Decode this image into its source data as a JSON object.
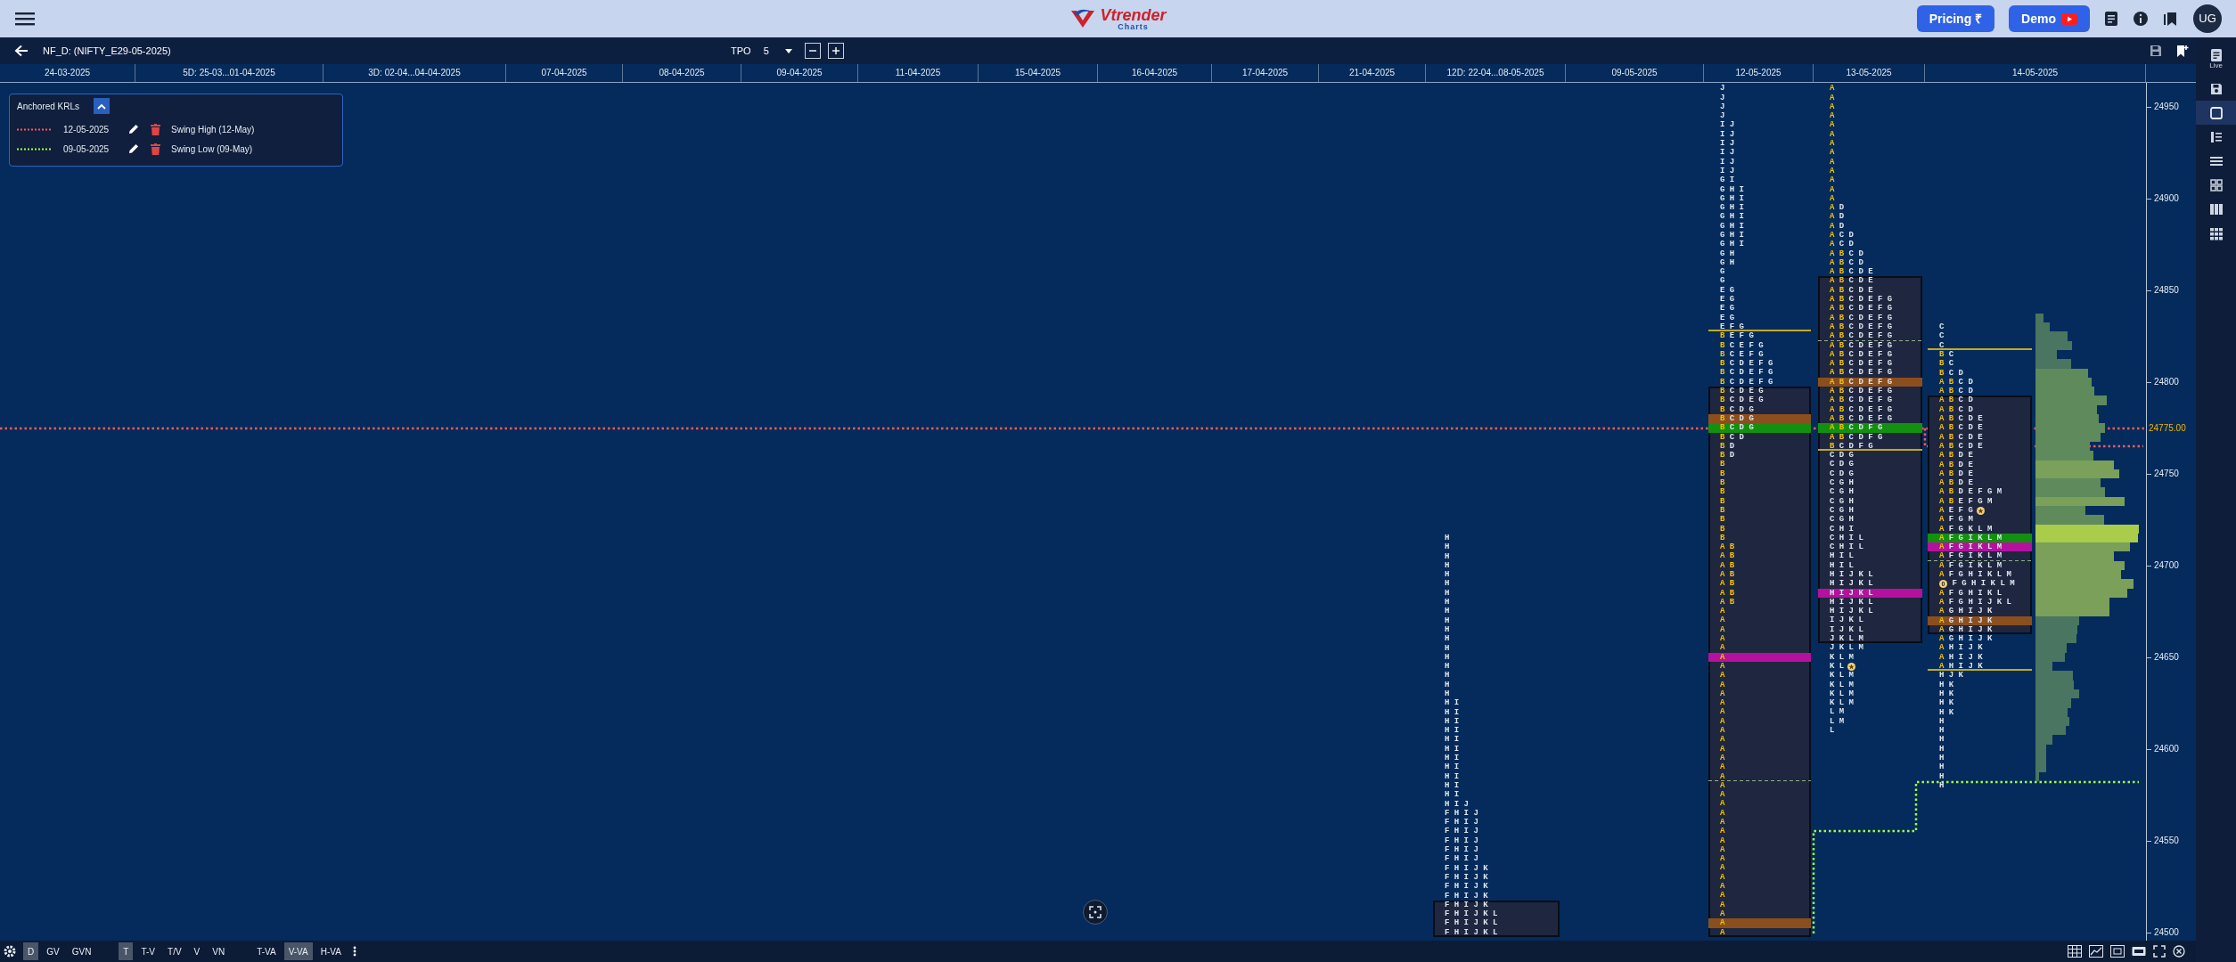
{
  "topbar": {
    "brand": "Vtrender",
    "brand_sub": "Charts",
    "buttons": [
      {
        "label": "Pricing ₹",
        "kind": "pricing"
      },
      {
        "label": "Demo",
        "kind": "demo"
      }
    ],
    "avatar": "UG"
  },
  "toolbar": {
    "symbol": "NF_D: (NIFTY_E29-05-2025)",
    "mode": "TPO",
    "tpo_size": "5"
  },
  "krl_panel": {
    "title": "Anchored KRLs",
    "expanded": true,
    "items": [
      {
        "date": "12-05-2025",
        "label": "Swing High (12-May)",
        "color": "#ff5a5a"
      },
      {
        "date": "09-05-2025",
        "label": "Swing Low (09-May)",
        "color": "#a4ff3c"
      }
    ]
  },
  "columns": [
    {
      "label": "24-03-2025"
    },
    {
      "label": "5D: 25-03...01-04-2025"
    },
    {
      "label": "3D: 02-04...04-04-2025"
    },
    {
      "label": "07-04-2025"
    },
    {
      "label": "08-04-2025"
    },
    {
      "label": "09-04-2025"
    },
    {
      "label": "11-04-2025"
    },
    {
      "label": "15-04-2025"
    },
    {
      "label": "16-04-2025"
    },
    {
      "label": "17-04-2025"
    },
    {
      "label": "21-04-2025"
    },
    {
      "label": "12D: 22-04...08-05-2025",
      "profile": {
        "histogram": false,
        "above_va": [
          {
            "tpo": "H"
          },
          {
            "tpo": "H"
          },
          {
            "tpo": "H"
          },
          {
            "tpo": "H"
          },
          {
            "tpo": "H"
          },
          {
            "tpo": "H"
          },
          {
            "tpo": "H"
          },
          {
            "tpo": "H"
          },
          {
            "tpo": "H"
          },
          {
            "tpo": "H"
          },
          {
            "tpo": "H"
          },
          {
            "tpo": "H"
          },
          {
            "tpo": "H"
          },
          {
            "tpo": "H"
          },
          {
            "tpo": "H"
          },
          {
            "tpo": "H"
          },
          {
            "tpo": "H"
          },
          {
            "tpo": "H"
          },
          {
            "tpo": "H I"
          },
          {
            "tpo": "H I"
          },
          {
            "tpo": "H I"
          },
          {
            "tpo": "H I"
          },
          {
            "tpo": "H I"
          },
          {
            "tpo": "H I"
          },
          {
            "tpo": "H I"
          },
          {
            "tpo": "H I"
          },
          {
            "tpo": "H I"
          },
          {
            "tpo": "H I"
          },
          {
            "tpo": "H I"
          },
          {
            "tpo": "H I J"
          },
          {
            "tpo": "F H I J"
          },
          {
            "tpo": "F H I J"
          },
          {
            "tpo": "F H I J"
          },
          {
            "tpo": "F H I J"
          },
          {
            "tpo": "F H I J"
          },
          {
            "tpo": "F H I J"
          },
          {
            "tpo": "F H I J K"
          },
          {
            "tpo": "F H I J K"
          },
          {
            "tpo": "F H I J K"
          },
          {
            "tpo": "F H I J K"
          }
        ],
        "value_area": [
          {
            "tpo": "F H I J K"
          },
          {
            "tpo": "F H I J K L"
          },
          {
            "tpo": "F H I J K L"
          },
          {
            "tpo": "F H I J K L"
          }
        ]
      }
    },
    {
      "label": "09-05-2025"
    },
    {
      "label": "12-05-2025",
      "profile": {
        "histogram": false,
        "above_va": [
          {
            "tpo": "J"
          },
          {
            "tpo": "J"
          },
          {
            "tpo": "J"
          },
          {
            "tpo": "J"
          },
          {
            "tpo": "I J"
          },
          {
            "tpo": "I J"
          },
          {
            "tpo": "I J"
          },
          {
            "tpo": "I J"
          },
          {
            "tpo": "I J"
          },
          {
            "tpo": "I J"
          },
          {
            "tpo": "G I"
          },
          {
            "tpo": "G H I"
          },
          {
            "tpo": "G H I"
          },
          {
            "tpo": "G H I"
          },
          {
            "tpo": "G H I"
          },
          {
            "tpo": "G H I"
          },
          {
            "tpo": "G H I"
          },
          {
            "tpo": "G H I"
          },
          {
            "tpo": "G H"
          },
          {
            "tpo": "G H"
          },
          {
            "tpo": "G"
          },
          {
            "tpo": "G"
          },
          {
            "tpo": "E G"
          },
          {
            "tpo": "E G"
          },
          {
            "tpo": "E G"
          },
          {
            "tpo": "E G"
          },
          {
            "tpo": "E F G",
            "kind": "solid-rule"
          },
          {
            "ib": "B",
            "tpo": "E F G"
          },
          {
            "ib": "B",
            "tpo": "C E F G"
          },
          {
            "ib": "B",
            "tpo": "C E F G"
          },
          {
            "ib": "B",
            "tpo": "C D E F G"
          },
          {
            "ib": "B",
            "tpo": "C D E F G"
          },
          {
            "ib": "B",
            "tpo": "C D E F G"
          }
        ],
        "value_area": [
          {
            "ib": "B",
            "tpo": "C D E G"
          },
          {
            "ib": "B",
            "tpo": "C D E G"
          },
          {
            "ib": "B",
            "tpo": "C D G"
          },
          {
            "ib": "B",
            "tpo": "C D G",
            "color": "#8b4f1d"
          },
          {
            "ib": "B",
            "tpo": "C D G",
            "color": "#13900f"
          },
          {
            "ib": "B",
            "tpo": "C D"
          },
          {
            "ib": "B",
            "tpo": "D"
          },
          {
            "ib": "B",
            "tpo": "D"
          },
          {
            "ib": "B"
          },
          {
            "ib": "B"
          },
          {
            "ib": "B"
          },
          {
            "ib": "B"
          },
          {
            "ib": "B"
          },
          {
            "ib": "B"
          },
          {
            "ib": "B"
          },
          {
            "ib": "B"
          },
          {
            "ib": "B"
          },
          {
            "ib": "A B"
          },
          {
            "ib": "A B"
          },
          {
            "ib": "A B"
          },
          {
            "ib": "A B"
          },
          {
            "ib": "A B"
          },
          {
            "ib": "A B"
          },
          {
            "ib": "A B"
          },
          {
            "ib": "A"
          },
          {
            "ib": "A"
          },
          {
            "ib": "A"
          },
          {
            "ib": "A"
          },
          {
            "ib": "A"
          },
          {
            "ib": "A",
            "color": "#b5119e"
          },
          {
            "ib": "A"
          },
          {
            "ib": "A"
          },
          {
            "ib": "A"
          },
          {
            "ib": "A"
          },
          {
            "ib": "A"
          },
          {
            "ib": "A"
          },
          {
            "ib": "A"
          },
          {
            "ib": "A"
          },
          {
            "ib": "A"
          },
          {
            "ib": "A"
          },
          {
            "ib": "A"
          },
          {
            "ib": "A"
          },
          {
            "ib": "A",
            "kind": "dashed-rule"
          },
          {
            "ib": "A"
          },
          {
            "ib": "A"
          },
          {
            "ib": "A"
          },
          {
            "ib": "A"
          },
          {
            "ib": "A"
          },
          {
            "ib": "A"
          },
          {
            "ib": "A"
          },
          {
            "ib": "A"
          },
          {
            "ib": "A"
          },
          {
            "ib": "A"
          },
          {
            "ib": "A"
          },
          {
            "ib": "A"
          },
          {
            "ib": "A"
          },
          {
            "ib": "A"
          },
          {
            "ib": "A"
          },
          {
            "ib": "A",
            "color": "#8b4f1d"
          },
          {
            "ib": "A"
          }
        ]
      }
    },
    {
      "label": "13-05-2025",
      "profile": {
        "histogram": false,
        "above_va": [
          {
            "ib": "A"
          },
          {
            "ib": "A"
          },
          {
            "ib": "A"
          },
          {
            "ib": "A"
          },
          {
            "ib": "A"
          },
          {
            "ib": "A"
          },
          {
            "ib": "A"
          },
          {
            "ib": "A"
          },
          {
            "ib": "A"
          },
          {
            "ib": "A"
          },
          {
            "ib": "A"
          },
          {
            "ib": "A"
          },
          {
            "ib": "A"
          },
          {
            "ib": "A",
            "tpo": "D"
          },
          {
            "ib": "A",
            "tpo": "D"
          },
          {
            "ib": "A",
            "tpo": "D"
          },
          {
            "ib": "A",
            "tpo": "C D"
          },
          {
            "ib": "A",
            "tpo": "C D"
          },
          {
            "ib": "A B",
            "tpo": "C D"
          },
          {
            "ib": "A B",
            "tpo": "C D"
          },
          {
            "ib": "A B",
            "tpo": "C D E"
          }
        ],
        "value_area": [
          {
            "ib": "A B",
            "tpo": "C D E"
          },
          {
            "ib": "A B",
            "tpo": "C D E"
          },
          {
            "ib": "A B",
            "tpo": "C D E F G"
          },
          {
            "ib": "A B",
            "tpo": "C D E F G"
          },
          {
            "ib": "A B",
            "tpo": "C D E F G"
          },
          {
            "ib": "A B",
            "tpo": "C D E F G"
          },
          {
            "ib": "A B",
            "tpo": "C D E F G",
            "kind": "dashed-rule"
          },
          {
            "ib": "A B",
            "tpo": "C D E F G"
          },
          {
            "ib": "A B",
            "tpo": "C D E F G"
          },
          {
            "ib": "A B",
            "tpo": "C D E F G"
          },
          {
            "ib": "A B",
            "tpo": "C D E F G"
          },
          {
            "ib": "A B",
            "tpo": "C D E F G",
            "color": "#8b4f1d"
          },
          {
            "ib": "A B",
            "tpo": "C D E F G"
          },
          {
            "ib": "A B",
            "tpo": "C D E F G"
          },
          {
            "ib": "A B",
            "tpo": "C D E F G"
          },
          {
            "ib": "A B",
            "tpo": "C D E F G"
          },
          {
            "ib": "A B",
            "tpo": "C D F G",
            "color": "#13900f"
          },
          {
            "ib": "A B",
            "tpo": "C D F G"
          },
          {
            "ib": "B",
            "tpo": "C D F G",
            "kind": "solid-rule"
          },
          {
            "tpo": "C D G"
          },
          {
            "tpo": "C D G"
          },
          {
            "tpo": "C D G"
          },
          {
            "tpo": "C G H"
          },
          {
            "tpo": "C G H"
          },
          {
            "tpo": "C G H"
          },
          {
            "tpo": "C G H"
          },
          {
            "tpo": "C G H"
          },
          {
            "tpo": "C H I"
          },
          {
            "tpo": "C H I L"
          },
          {
            "tpo": "C H I L"
          },
          {
            "tpo": "H I L"
          },
          {
            "tpo": "H I L"
          },
          {
            "tpo": "H I J K L"
          },
          {
            "tpo": "H I J K L"
          },
          {
            "tpo": "H I J K L",
            "color": "#b5119e"
          },
          {
            "tpo": "H I J K L"
          },
          {
            "tpo": "H I J K L"
          },
          {
            "tpo": "I J K L"
          },
          {
            "tpo": "I J K L"
          },
          {
            "tpo": "J K L M"
          }
        ],
        "below_va": [
          {
            "tpo": "J K L M"
          },
          {
            "tpo": "K L M"
          },
          {
            "tpo": "K L",
            "kind": "starred"
          },
          {
            "tpo": "K L M"
          },
          {
            "tpo": "K L M"
          },
          {
            "tpo": "K L M"
          },
          {
            "tpo": "K L M"
          },
          {
            "tpo": "L M"
          },
          {
            "tpo": "L M"
          },
          {
            "tpo": "L"
          }
        ]
      }
    },
    {
      "label": "14-05-2025",
      "profile": {
        "histogram": true,
        "above_va": [
          {
            "tpo": "C"
          },
          {
            "tpo": "C"
          },
          {
            "tpo": "C",
            "kind": "solid-rule"
          },
          {
            "ib": "B",
            "tpo": "C"
          },
          {
            "ib": "B",
            "tpo": "C"
          },
          {
            "ib": "B",
            "tpo": "C D"
          },
          {
            "ib": "A B",
            "tpo": "C D"
          },
          {
            "ib": "A B",
            "tpo": "C D"
          }
        ],
        "value_area": [
          {
            "ib": "A B",
            "tpo": "C D"
          },
          {
            "ib": "A B",
            "tpo": "C D"
          },
          {
            "ib": "A B",
            "tpo": "C D E"
          },
          {
            "ib": "A B",
            "tpo": "C D E"
          },
          {
            "ib": "A B",
            "tpo": "C D E"
          },
          {
            "ib": "A B",
            "tpo": "C D E"
          },
          {
            "ib": "A B",
            "tpo": "D E"
          },
          {
            "ib": "A B",
            "tpo": "D E"
          },
          {
            "ib": "A B",
            "tpo": "D E"
          },
          {
            "ib": "A B",
            "tpo": "D E"
          },
          {
            "ib": "A B",
            "tpo": "D E F G M"
          },
          {
            "ib": "A B",
            "tpo": "E F G M"
          },
          {
            "ib": "A",
            "tpo": "E F G",
            "kind": "starred"
          },
          {
            "ib": "A",
            "tpo": "F G M"
          },
          {
            "ib": "A",
            "tpo": "F G K L M"
          },
          {
            "ib": "A",
            "tpo": "F G I K L M",
            "color": "#13900f"
          },
          {
            "ib": "A",
            "tpo": "F G I K L M",
            "color": "#b5119e"
          },
          {
            "ib": "A",
            "tpo": "F G I K L M",
            "kind": "dashed-rule"
          },
          {
            "ib": "A",
            "tpo": "F G I K L M"
          },
          {
            "ib": "A",
            "tpo": "F G H I K L M"
          },
          {
            "badge": "0",
            "tpo": "F G H I K L M"
          },
          {
            "ib": "A",
            "tpo": "F G H I K L"
          },
          {
            "ib": "A",
            "tpo": "F G H I J K L"
          },
          {
            "ib": "A",
            "tpo": "G H I J K"
          },
          {
            "ib": "A",
            "tpo": "G H I J K",
            "color": "#8b4f1d"
          },
          {
            "ib": "A",
            "tpo": "G H I J K"
          }
        ],
        "below_va": [
          {
            "ib": "A",
            "tpo": "G H I J K"
          },
          {
            "ib": "A",
            "tpo": "H I J K"
          },
          {
            "ib": "A",
            "tpo": "H I J K"
          },
          {
            "ib": "A",
            "tpo": "H I J K",
            "kind": "solid-rule"
          },
          {
            "tpo": "H J K"
          },
          {
            "tpo": "H K"
          },
          {
            "tpo": "H K"
          },
          {
            "tpo": "H K"
          },
          {
            "tpo": "H K"
          },
          {
            "tpo": "H"
          },
          {
            "tpo": "H"
          },
          {
            "tpo": "H"
          },
          {
            "tpo": "H"
          },
          {
            "tpo": "H"
          },
          {
            "tpo": "H"
          },
          {
            "tpo": "H"
          },
          {
            "tpo": "H"
          }
        ]
      }
    }
  ],
  "price_axis": {
    "labels": [
      "24950",
      "24900",
      "24850",
      "24800",
      "24750",
      "24700",
      "24650",
      "24600",
      "24550",
      "24500"
    ],
    "current": "24775.00"
  },
  "sidebar": {
    "items": [
      {
        "label": "Live",
        "selected": false
      },
      {
        "selected": false
      },
      {
        "selected": true
      },
      {
        "selected": false
      },
      {
        "selected": false
      },
      {
        "selected": false
      },
      {
        "selected": false
      },
      {
        "selected": false
      }
    ]
  },
  "bottom_bar": {
    "groups": [
      [
        {
          "label": "D",
          "selected": true
        },
        {
          "label": "GV",
          "selected": false
        },
        {
          "label": "GVN",
          "selected": false
        }
      ],
      [
        {
          "label": "T",
          "selected": true
        },
        {
          "label": "T-V",
          "selected": false
        },
        {
          "label": "T/V",
          "selected": false
        },
        {
          "label": "V",
          "selected": false
        },
        {
          "label": "VN",
          "selected": false
        }
      ],
      [
        {
          "label": "T-VA",
          "selected": false
        },
        {
          "label": "V-VA",
          "selected": true
        },
        {
          "label": "H-VA",
          "selected": false
        }
      ]
    ]
  }
}
